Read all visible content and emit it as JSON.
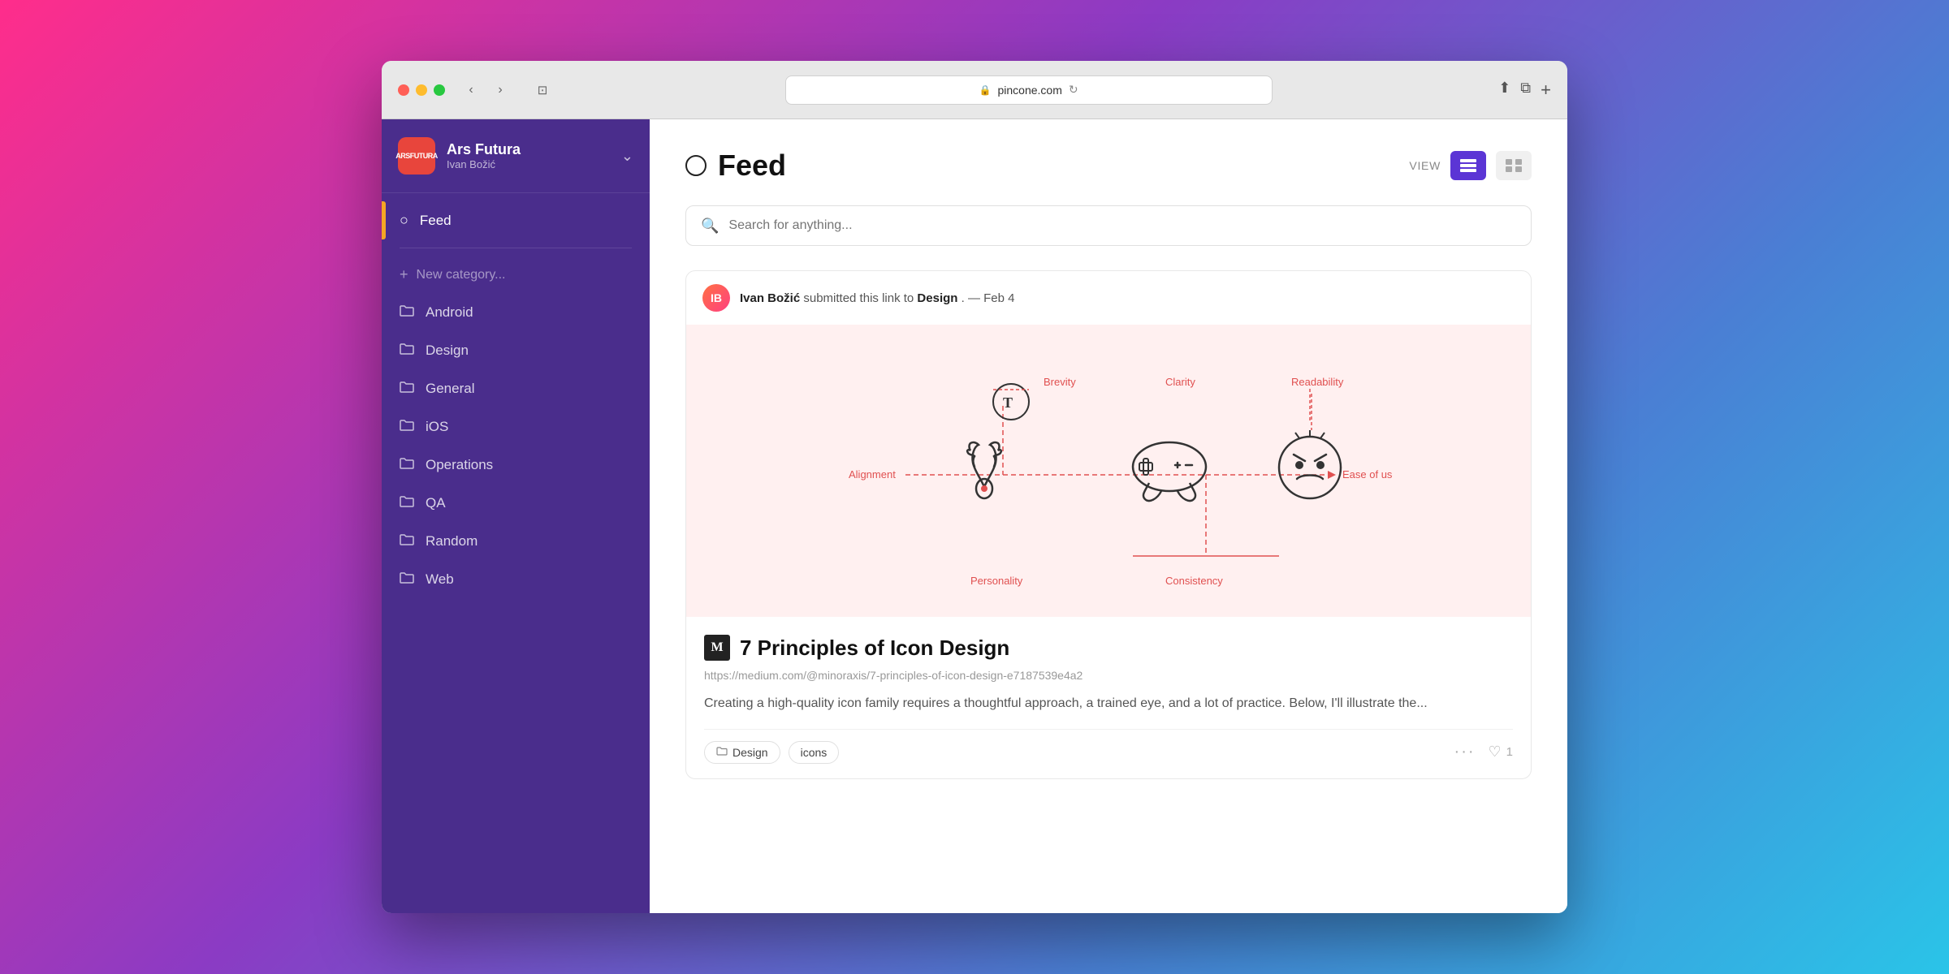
{
  "browser": {
    "url": "pincone.com",
    "tab_icon": "🔒"
  },
  "sidebar": {
    "brand": {
      "logo": "arsfutura",
      "name": "Ars Futura",
      "user": "Ivan Božić"
    },
    "active_item": "Feed",
    "new_category_label": "New category...",
    "items": [
      {
        "id": "feed",
        "label": "Feed",
        "icon": "circle"
      },
      {
        "id": "android",
        "label": "Android",
        "icon": "folder"
      },
      {
        "id": "design",
        "label": "Design",
        "icon": "folder"
      },
      {
        "id": "general",
        "label": "General",
        "icon": "folder"
      },
      {
        "id": "ios",
        "label": "iOS",
        "icon": "folder"
      },
      {
        "id": "operations",
        "label": "Operations",
        "icon": "folder"
      },
      {
        "id": "qa",
        "label": "QA",
        "icon": "folder"
      },
      {
        "id": "random",
        "label": "Random",
        "icon": "folder"
      },
      {
        "id": "web",
        "label": "Web",
        "icon": "folder"
      }
    ]
  },
  "main": {
    "page_title": "Feed",
    "view_label": "VIEW",
    "search_placeholder": "Search for anything...",
    "feed_items": [
      {
        "user": "Ivan Božić",
        "action": "submitted this link to",
        "category": "Design",
        "date": "Feb 4",
        "article": {
          "title": "7 Principles of Icon Design",
          "url": "https://medium.com/@minoraxis/7-principles-of-icon-design-e7187539e4a2",
          "description": "Creating a high-quality icon family requires a thoughtful approach, a trained eye, and a lot of practice. Below, I'll illustrate the...",
          "tags": [
            "Design",
            "icons"
          ],
          "likes": 1
        }
      }
    ]
  },
  "diagram": {
    "labels": [
      "Brevity",
      "Clarity",
      "Readability",
      "Alignment",
      "Ease of use",
      "Personality",
      "Consistency"
    ]
  }
}
